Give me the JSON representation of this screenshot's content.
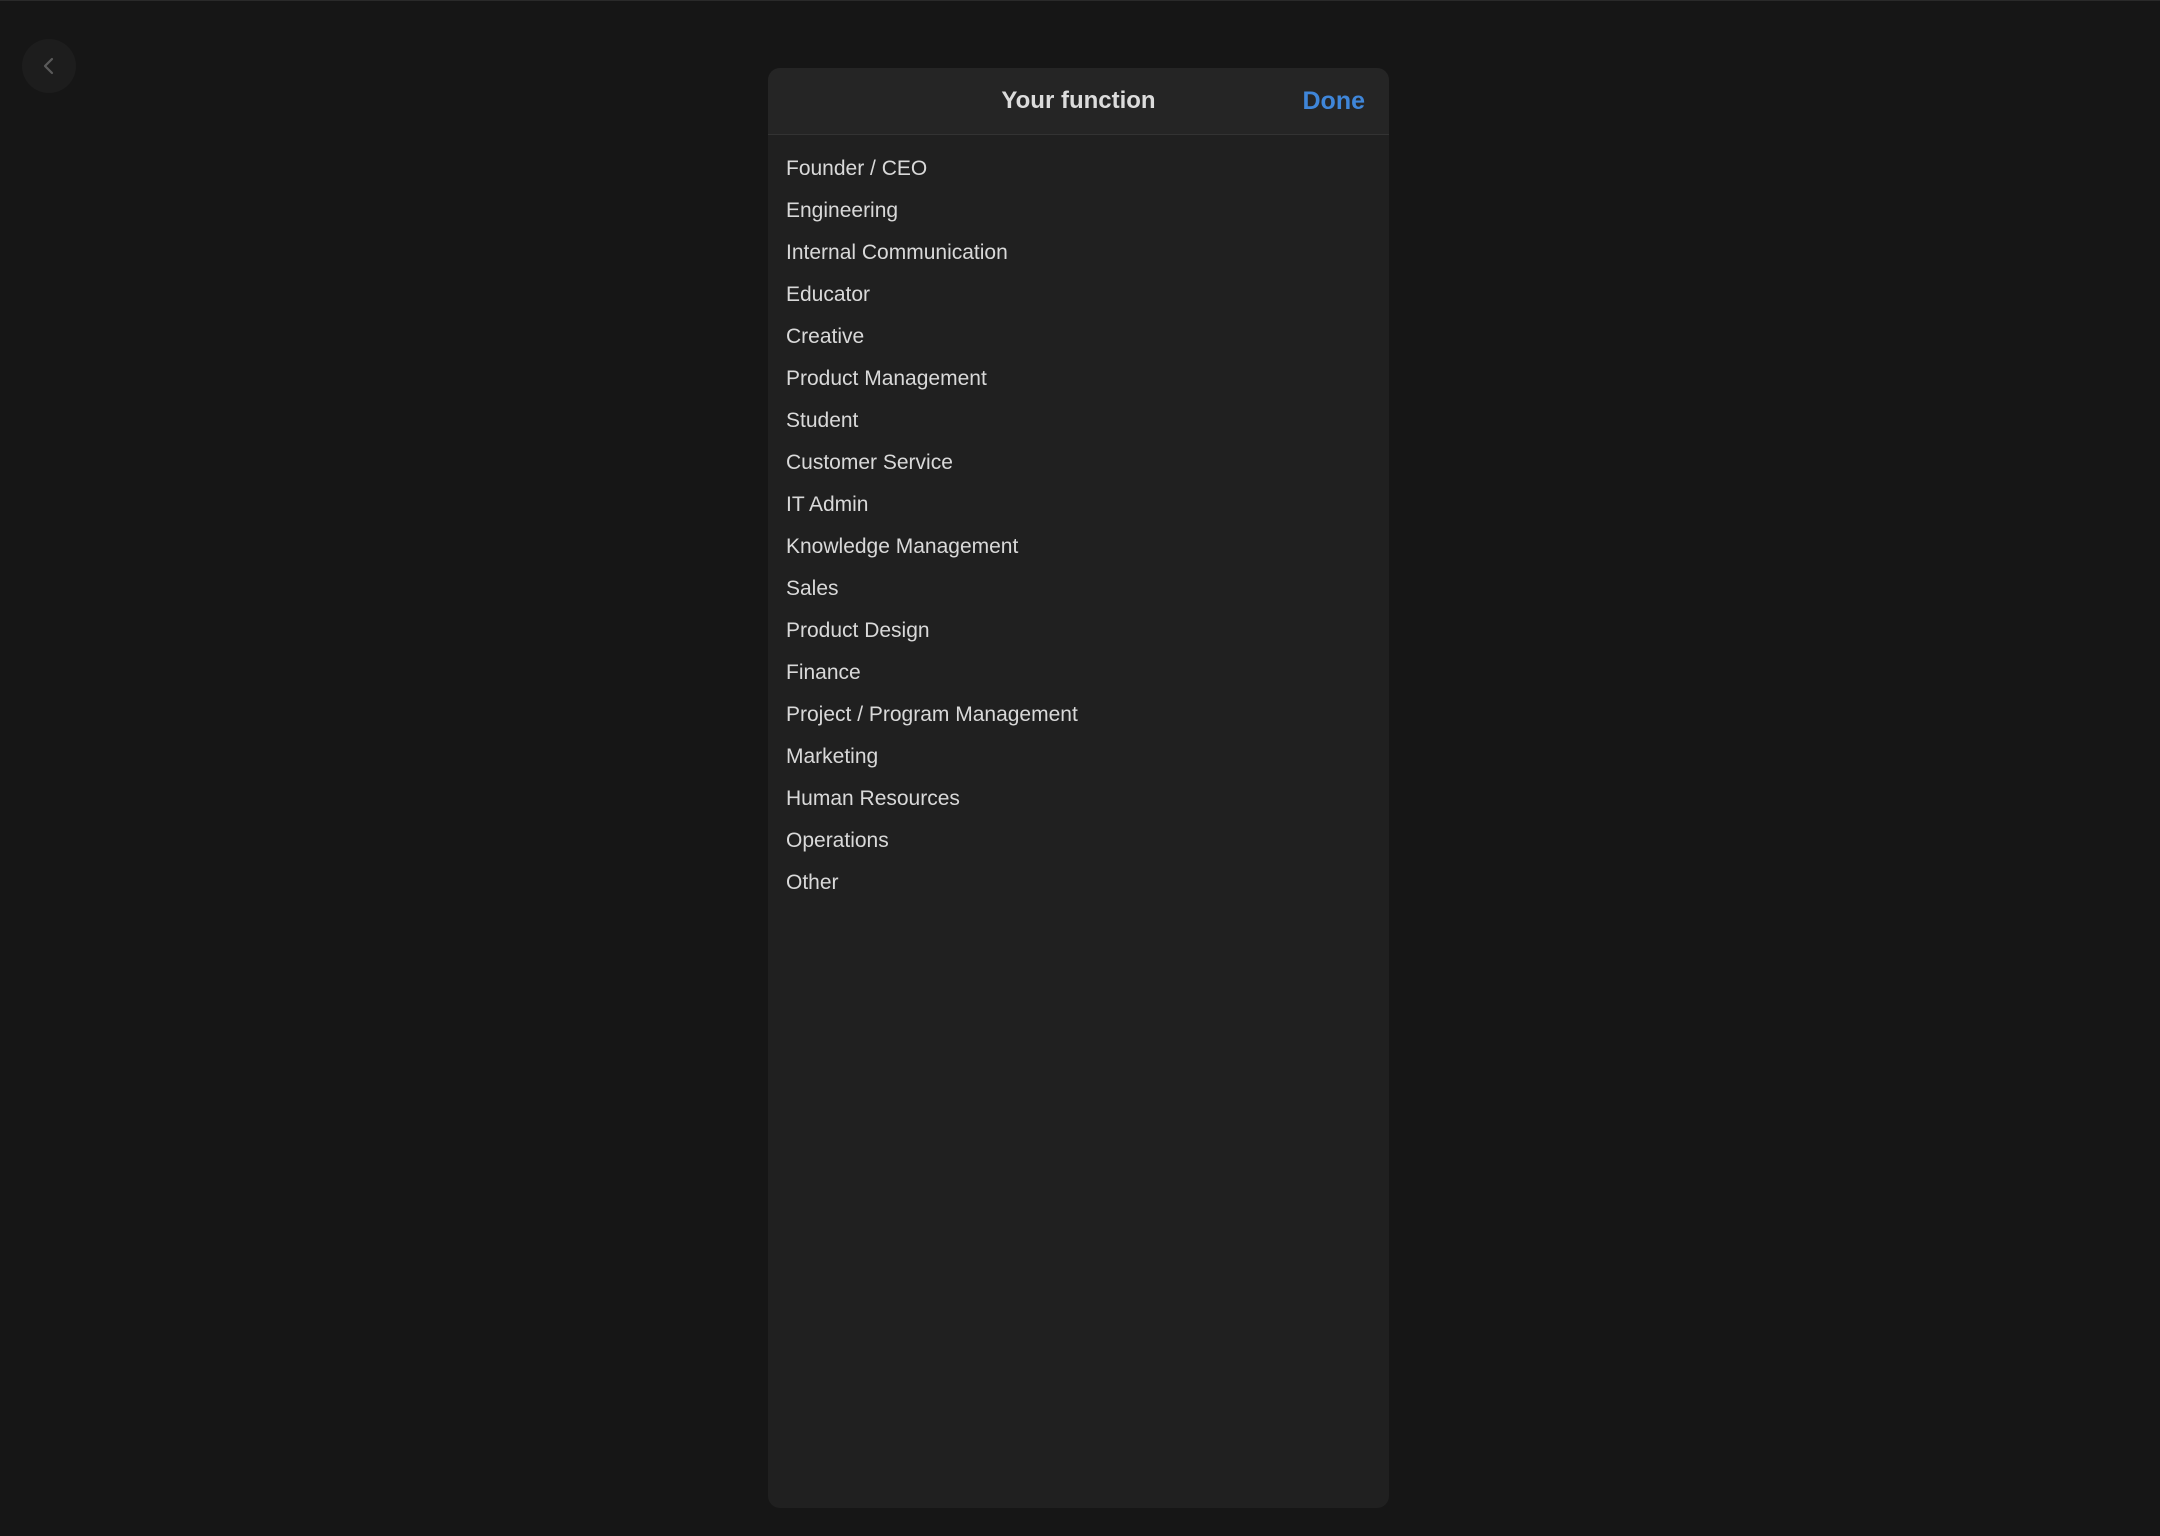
{
  "back_button": {
    "icon": "chevron-left-icon"
  },
  "sheet": {
    "title": "Your function",
    "done_label": "Done",
    "accent_color": "#3f86d9"
  },
  "functions": [
    "Founder / CEO",
    "Engineering",
    "Internal Communication",
    "Educator",
    "Creative",
    "Product Management",
    "Student",
    "Customer Service",
    "IT Admin",
    "Knowledge Management",
    "Sales",
    "Product Design",
    "Finance",
    "Project / Program Management",
    "Marketing",
    "Human Resources",
    "Operations",
    "Other"
  ]
}
